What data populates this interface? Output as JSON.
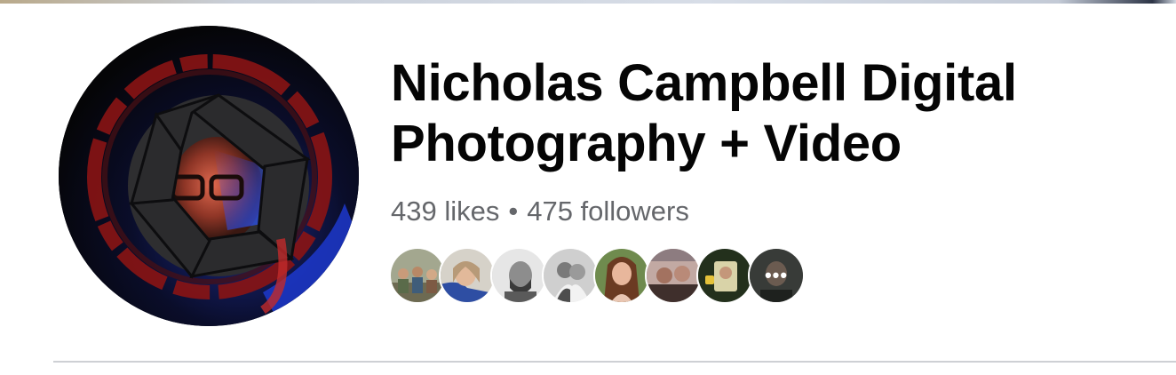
{
  "page": {
    "name": "Nicholas Campbell Digital Photography + Video",
    "likes": "439 likes",
    "separator": "•",
    "followers": "475 followers"
  },
  "friends": [
    {
      "avatar": "friend-avatar-1",
      "color": "#8a8f7d"
    },
    {
      "avatar": "friend-avatar-2",
      "color": "#6f7fa8"
    },
    {
      "avatar": "friend-avatar-3",
      "color": "#9a9a9a"
    },
    {
      "avatar": "friend-avatar-4",
      "color": "#b4b4b4"
    },
    {
      "avatar": "friend-avatar-5",
      "color": "#a9785e"
    },
    {
      "avatar": "friend-avatar-6",
      "color": "#7a5d57"
    },
    {
      "avatar": "friend-avatar-7",
      "color": "#2f3d25"
    },
    {
      "avatar": "friend-avatar-8",
      "color": "#4a4f4a"
    }
  ],
  "more_friends_icon": "more-dots-icon",
  "colors": {
    "title": "#050505",
    "secondary_text": "#65676b",
    "divider": "#ced0d4"
  }
}
